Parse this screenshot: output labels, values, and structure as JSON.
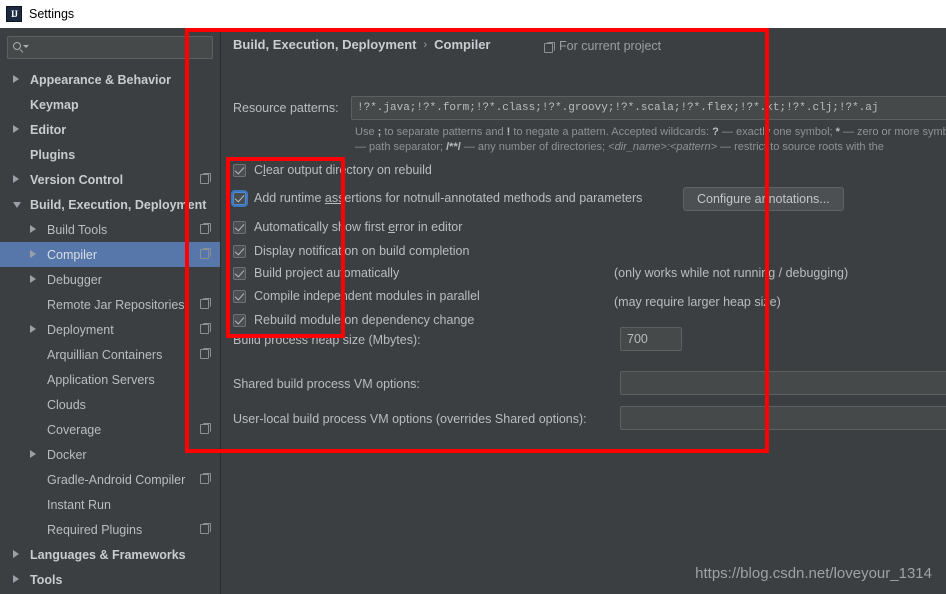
{
  "window": {
    "title": "Settings",
    "icon": "intellij-idea-icon"
  },
  "colors": {
    "accent_selection": "#5777aa",
    "annotation_red": "#fe0000",
    "background": "#3c3f41",
    "field_background": "#45494a",
    "text": "#b9bdc0"
  },
  "sidebar": {
    "search": {
      "value": "",
      "placeholder": ""
    },
    "items": [
      {
        "label": "Appearance & Behavior",
        "indent": 0,
        "arrow": "right",
        "bold": true,
        "copy": false,
        "selected": false
      },
      {
        "label": "Keymap",
        "indent": 0,
        "arrow": "none",
        "bold": true,
        "copy": false,
        "selected": false
      },
      {
        "label": "Editor",
        "indent": 0,
        "arrow": "right",
        "bold": true,
        "copy": false,
        "selected": false
      },
      {
        "label": "Plugins",
        "indent": 0,
        "arrow": "none",
        "bold": true,
        "copy": false,
        "selected": false
      },
      {
        "label": "Version Control",
        "indent": 0,
        "arrow": "right",
        "bold": true,
        "copy": true,
        "selected": false
      },
      {
        "label": "Build, Execution, Deployment",
        "indent": 0,
        "arrow": "down",
        "bold": true,
        "copy": false,
        "selected": false
      },
      {
        "label": "Build Tools",
        "indent": 1,
        "arrow": "right",
        "bold": false,
        "copy": true,
        "selected": false
      },
      {
        "label": "Compiler",
        "indent": 1,
        "arrow": "right",
        "bold": false,
        "copy": true,
        "selected": true
      },
      {
        "label": "Debugger",
        "indent": 1,
        "arrow": "right",
        "bold": false,
        "copy": false,
        "selected": false
      },
      {
        "label": "Remote Jar Repositories",
        "indent": 1,
        "arrow": "none",
        "bold": false,
        "copy": true,
        "selected": false
      },
      {
        "label": "Deployment",
        "indent": 1,
        "arrow": "right",
        "bold": false,
        "copy": true,
        "selected": false
      },
      {
        "label": "Arquillian Containers",
        "indent": 1,
        "arrow": "none",
        "bold": false,
        "copy": true,
        "selected": false
      },
      {
        "label": "Application Servers",
        "indent": 1,
        "arrow": "none",
        "bold": false,
        "copy": false,
        "selected": false
      },
      {
        "label": "Clouds",
        "indent": 1,
        "arrow": "none",
        "bold": false,
        "copy": false,
        "selected": false
      },
      {
        "label": "Coverage",
        "indent": 1,
        "arrow": "none",
        "bold": false,
        "copy": true,
        "selected": false
      },
      {
        "label": "Docker",
        "indent": 1,
        "arrow": "right",
        "bold": false,
        "copy": false,
        "selected": false
      },
      {
        "label": "Gradle-Android Compiler",
        "indent": 1,
        "arrow": "none",
        "bold": false,
        "copy": true,
        "selected": false
      },
      {
        "label": "Instant Run",
        "indent": 1,
        "arrow": "none",
        "bold": false,
        "copy": false,
        "selected": false
      },
      {
        "label": "Required Plugins",
        "indent": 1,
        "arrow": "none",
        "bold": false,
        "copy": true,
        "selected": false
      },
      {
        "label": "Languages & Frameworks",
        "indent": 0,
        "arrow": "right",
        "bold": true,
        "copy": false,
        "selected": false
      },
      {
        "label": "Tools",
        "indent": 0,
        "arrow": "right",
        "bold": true,
        "copy": false,
        "selected": false
      }
    ]
  },
  "content": {
    "breadcrumb": {
      "root": "Build, Execution, Deployment",
      "separator": "›",
      "leaf": "Compiler"
    },
    "scope_label": "For current project",
    "resource_patterns": {
      "label": "Resource patterns:",
      "value": "!?*.java;!?*.form;!?*.class;!?*.groovy;!?*.scala;!?*.flex;!?*.kt;!?*.clj;!?*.aj"
    },
    "hint_line1_a": "Use ",
    "hint_line1_semicolon": ";",
    "hint_line1_b": " to separate patterns and ",
    "hint_line1_bang": "!",
    "hint_line1_c": " to negate a pattern. Accepted wildcards: ",
    "hint_line1_q": "?",
    "hint_line1_d": " — exactly one symbol; ",
    "hint_line1_star": "*",
    "hint_line1_e": " — zero or more symbols; ",
    "hint_line1_slash": "/",
    "hint_line2_a": " — path separator; ",
    "hint_line2_globs": "/**/",
    "hint_line2_b": " — any number of directories; ",
    "hint_line2_dir": "<dir_name>:<pattern>",
    "hint_line2_c": " — restrict to source roots with the ",
    "checkboxes": [
      {
        "label_pre": "C",
        "label_underline": "l",
        "label_post": "ear output directory on rebuild",
        "checked": true,
        "focused": false
      },
      {
        "label_pre": "Add runtime ",
        "label_underline": "ass",
        "label_post": "ertions for notnull-annotated methods and parameters",
        "checked": true,
        "focused": true
      },
      {
        "label_pre": "Automatically show first ",
        "label_underline": "e",
        "label_post": "rror in editor",
        "checked": true,
        "focused": false
      },
      {
        "label_pre": "Display notification on build completion",
        "label_underline": "",
        "label_post": "",
        "checked": true,
        "focused": false
      },
      {
        "label_pre": "Build project automatically",
        "label_underline": "",
        "label_post": "",
        "checked": true,
        "focused": false
      },
      {
        "label_pre": "Compile independent modules in parallel",
        "label_underline": "",
        "label_post": "",
        "checked": true,
        "focused": false
      },
      {
        "label_pre": "Rebuild module on dependency change",
        "label_underline": "",
        "label_post": "",
        "checked": true,
        "focused": false
      }
    ],
    "configure_annotations_button": "Configure annotations...",
    "note_build_auto": "(only works while not running / debugging)",
    "note_parallel": "(may require larger heap size)",
    "fields": [
      {
        "label": "Build process heap size (Mbytes):",
        "value": "700"
      },
      {
        "label": "Shared build process VM options:",
        "value": ""
      },
      {
        "label": "User-local build process VM options (overrides Shared options):",
        "value": ""
      }
    ]
  },
  "watermark": "https://blog.csdn.net/loveyour_1314"
}
